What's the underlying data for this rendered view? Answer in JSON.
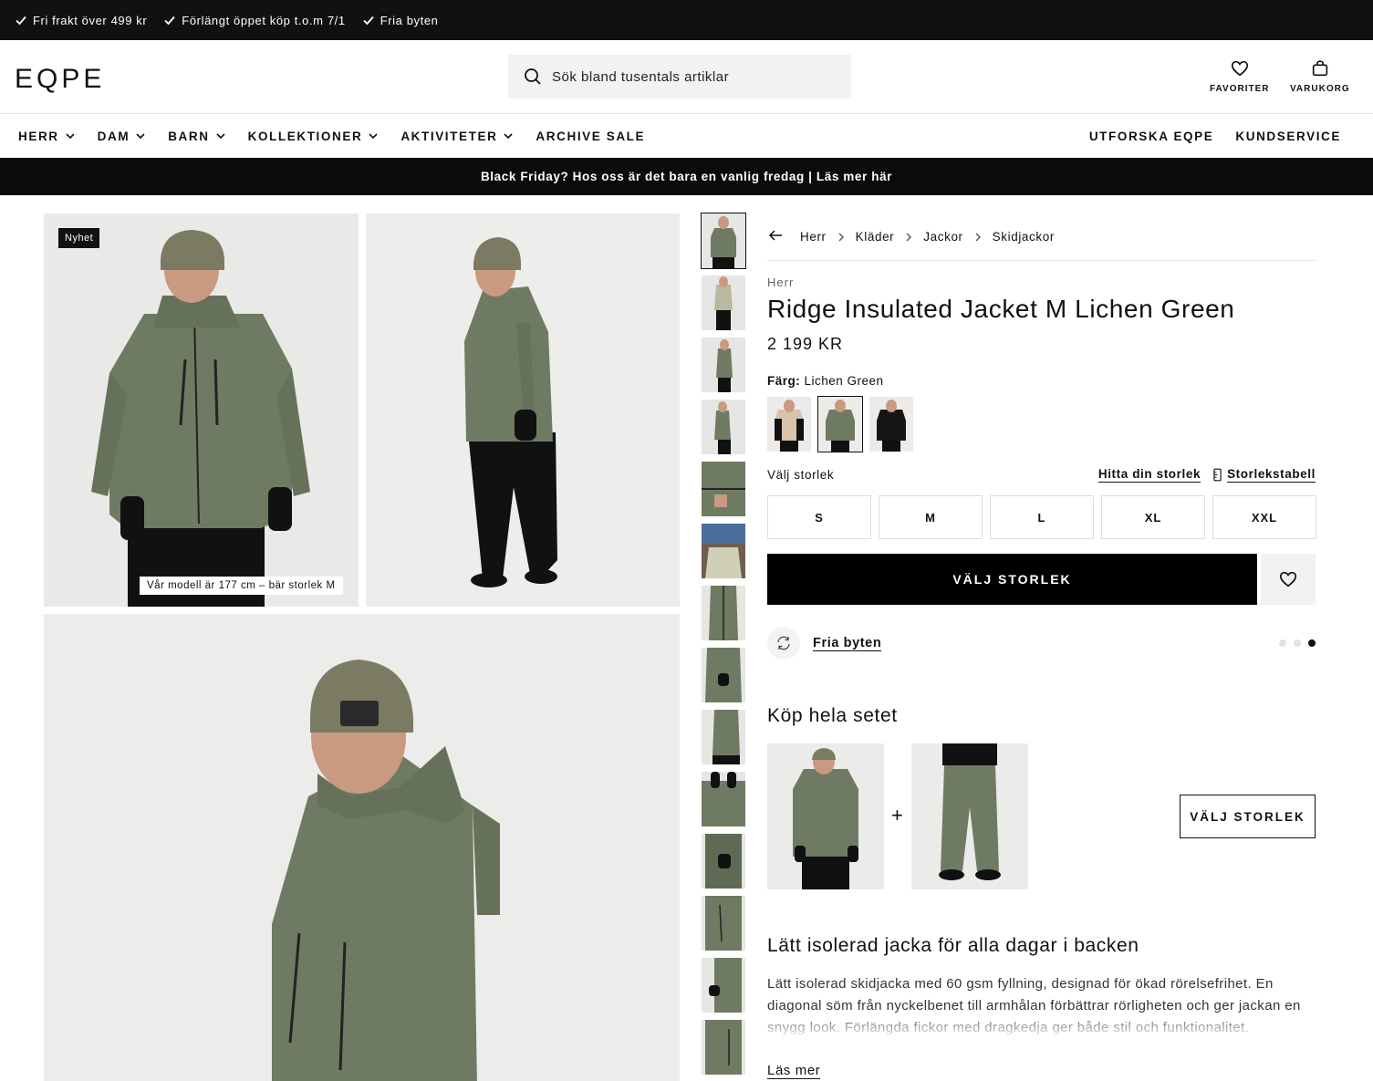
{
  "usp_bar": [
    "Fri frakt över 499 kr",
    "Förlängt öppet köp t.o.m 7/1",
    "Fria byten"
  ],
  "header": {
    "logo": "EQPE",
    "search_placeholder": "Sök bland tusentals artiklar",
    "favorites_label": "FAVORITER",
    "cart_label": "VARUKORG"
  },
  "nav": {
    "left": [
      {
        "label": "HERR",
        "dropdown": true
      },
      {
        "label": "DAM",
        "dropdown": true
      },
      {
        "label": "BARN",
        "dropdown": true
      },
      {
        "label": "KOLLEKTIONER",
        "dropdown": true
      },
      {
        "label": "AKTIVITETER",
        "dropdown": true
      },
      {
        "label": "ARCHIVE SALE",
        "dropdown": false
      }
    ],
    "right": [
      "UTFORSKA EQPE",
      "KUNDSERVICE"
    ]
  },
  "promo": "Black Friday? Hos oss är det bara en vanlig fredag | Läs mer här",
  "gallery": {
    "badge": "Nyhet",
    "model_note": "Vår modell är 177 cm – bär storlek M",
    "thumbnail_count": 14
  },
  "product": {
    "breadcrumb": [
      "Herr",
      "Kläder",
      "Jackor",
      "Skidjackor"
    ],
    "category": "Herr",
    "title": "Ridge Insulated Jacket M Lichen Green",
    "price": "2 199 KR",
    "color_label": "Färg:",
    "color_value": "Lichen Green",
    "size_label": "Välj storlek",
    "find_size": "Hitta din storlek",
    "size_chart": "Storlekstabell",
    "sizes": [
      "S",
      "M",
      "L",
      "XL",
      "XXL"
    ],
    "cta": "VÄLJ STORLEK",
    "usp": "Fria byten",
    "set_title": "Köp hela setet",
    "set_plus": "+",
    "set_cta": "VÄLJ STORLEK",
    "desc_title": "Lätt isolerad jacka för alla dagar i backen",
    "description": "Lätt isolerad skidjacka med 60 gsm fyllning, designad för ökad rörelsefrihet. En diagonal söm från nyckelbenet till armhålan förbättrar rörligheten och ger jackan en snygg look. Förlängda fickor med dragkedja ger både stil och funktionalitet.",
    "read_more": "Läs mer"
  },
  "colors": {
    "jacket": "#6f7a62",
    "pants": "#111111",
    "beanie": "#7b7a63",
    "skin": "#c99a7f"
  }
}
